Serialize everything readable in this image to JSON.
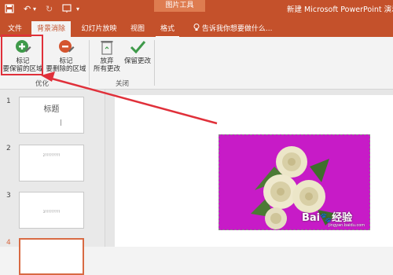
{
  "quick_access": {
    "redo": "↻"
  },
  "context_tab": {
    "label": "图片工具"
  },
  "window": {
    "title": "新建 Microsoft PowerPoint 演示文"
  },
  "tabs": [
    {
      "label": "文件"
    },
    {
      "label": "背景消除"
    },
    {
      "label": "幻灯片放映"
    },
    {
      "label": "视图"
    },
    {
      "label": "格式"
    }
  ],
  "tell_me": {
    "label": "告诉我你想要做什么..."
  },
  "ribbon": {
    "mark_keep": {
      "line1": "标记",
      "line2": "要保留的区域"
    },
    "mark_remove": {
      "line1": "标记",
      "line2": "要删除的区域"
    },
    "discard": {
      "line1": "放弃",
      "line2": "所有更改"
    },
    "keep_changes": {
      "line1": "保留更改"
    },
    "group_refine": "优化",
    "group_close": "关闭"
  },
  "slides": [
    {
      "number": "1",
      "title": "标题"
    },
    {
      "number": "2",
      "text": "2?????????"
    },
    {
      "number": "3",
      "text": "3?????????"
    },
    {
      "number": "4"
    }
  ],
  "watermark": {
    "brand": "Bai",
    "brand2": "经验",
    "url": "jingyan.baidu.com"
  },
  "colors": {
    "accent": "#c4512b",
    "highlight": "#e0303a",
    "photo_bg": "#c71bc7"
  }
}
